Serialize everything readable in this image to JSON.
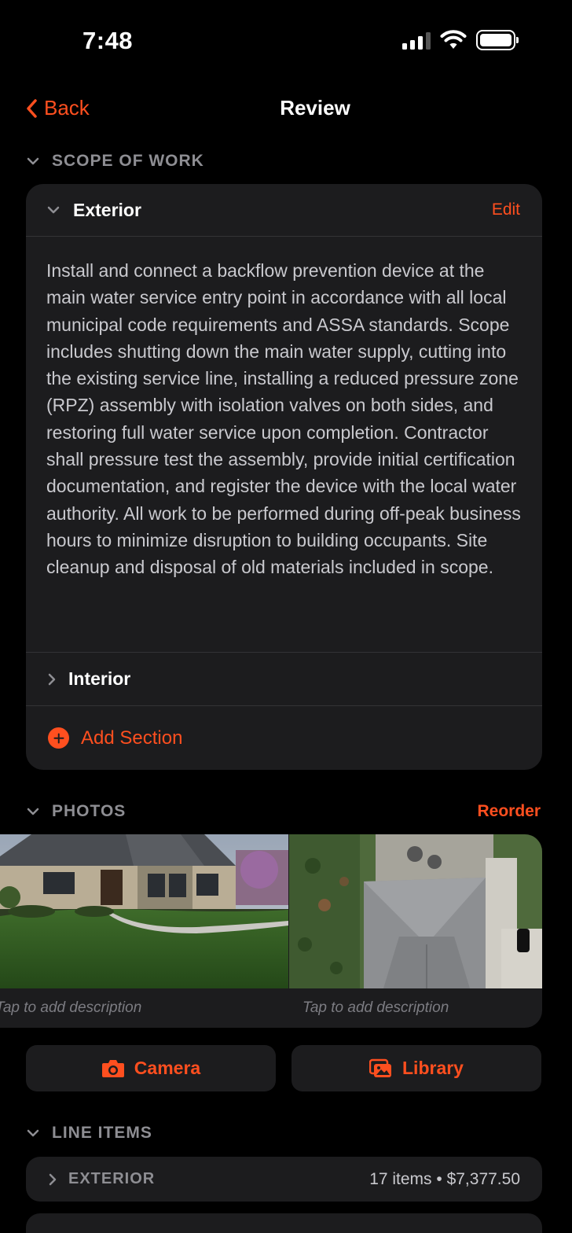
{
  "status_bar": {
    "time": "7:48"
  },
  "nav": {
    "back_label": "Back",
    "title": "Review"
  },
  "scope_of_work": {
    "header": "SCOPE OF WORK",
    "sections": [
      {
        "label": "Exterior",
        "edit_label": "Edit",
        "expanded": true,
        "description": "Install and connect a backflow prevention device at the main water service entry point in accordance with all local municipal code requirements and ASSA standards. Scope includes shutting down the main water supply, cutting into the existing service line, installing a reduced pressure zone (RPZ) assembly with isolation valves on both sides, and restoring full water service upon completion. Contractor shall pressure test the assembly, provide initial certification documentation, and register the device with the local water authority. All work to be performed during off-peak business hours to minimize disruption to building occupants. Site cleanup and disposal of old materials included in scope."
      },
      {
        "label": "Interior",
        "expanded": false
      }
    ],
    "add_section_label": "Add Section"
  },
  "photos": {
    "header": "PHOTOS",
    "reorder_label": "Reorder",
    "items": [
      {
        "description_placeholder": "Tap to add description"
      },
      {
        "description_placeholder": "Tap to add description"
      }
    ]
  },
  "buttons": {
    "camera_label": "Camera",
    "library_label": "Library"
  },
  "line_items": {
    "header": "LINE ITEMS",
    "groups": [
      {
        "label": "EXTERIOR",
        "summary": "17 items • $7,377.50"
      }
    ]
  },
  "colors": {
    "accent": "#ff4f1f",
    "background": "#000000",
    "card": "#1c1c1e",
    "secondary_text": "#8e8e93"
  }
}
